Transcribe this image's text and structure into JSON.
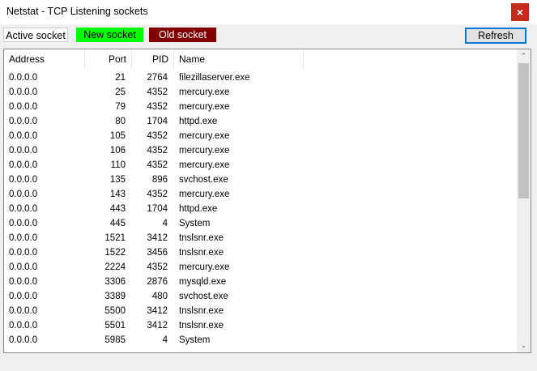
{
  "window": {
    "title": "Netstat - TCP Listening sockets",
    "close_glyph": "×"
  },
  "legend": {
    "active": "Active socket",
    "new": "New socket",
    "old": "Old socket"
  },
  "toolbar": {
    "refresh_label": "Refresh"
  },
  "table": {
    "columns": [
      "Address",
      "Port",
      "PID",
      "Name"
    ],
    "rows": [
      [
        "0.0.0.0",
        "21",
        "2764",
        "filezillaserver.exe"
      ],
      [
        "0.0.0.0",
        "25",
        "4352",
        "mercury.exe"
      ],
      [
        "0.0.0.0",
        "79",
        "4352",
        "mercury.exe"
      ],
      [
        "0.0.0.0",
        "80",
        "1704",
        "httpd.exe"
      ],
      [
        "0.0.0.0",
        "105",
        "4352",
        "mercury.exe"
      ],
      [
        "0.0.0.0",
        "106",
        "4352",
        "mercury.exe"
      ],
      [
        "0.0.0.0",
        "110",
        "4352",
        "mercury.exe"
      ],
      [
        "0.0.0.0",
        "135",
        "896",
        "svchost.exe"
      ],
      [
        "0.0.0.0",
        "143",
        "4352",
        "mercury.exe"
      ],
      [
        "0.0.0.0",
        "443",
        "1704",
        "httpd.exe"
      ],
      [
        "0.0.0.0",
        "445",
        "4",
        "System"
      ],
      [
        "0.0.0.0",
        "1521",
        "3412",
        "tnslsnr.exe"
      ],
      [
        "0.0.0.0",
        "1522",
        "3456",
        "tnslsnr.exe"
      ],
      [
        "0.0.0.0",
        "2224",
        "4352",
        "mercury.exe"
      ],
      [
        "0.0.0.0",
        "3306",
        "2876",
        "mysqld.exe"
      ],
      [
        "0.0.0.0",
        "3389",
        "480",
        "svchost.exe"
      ],
      [
        "0.0.0.0",
        "5500",
        "3412",
        "tnslsnr.exe"
      ],
      [
        "0.0.0.0",
        "5501",
        "3412",
        "tnslsnr.exe"
      ],
      [
        "0.0.0.0",
        "5985",
        "4",
        "System"
      ]
    ]
  },
  "scrollbar": {
    "up_glyph": "⌃",
    "down_glyph": "⌄"
  },
  "colors": {
    "new_socket": "#00ff00",
    "old_socket": "#800000",
    "active_socket": "#ffffff",
    "close": "#c42b1c",
    "focus": "#0078d7"
  }
}
